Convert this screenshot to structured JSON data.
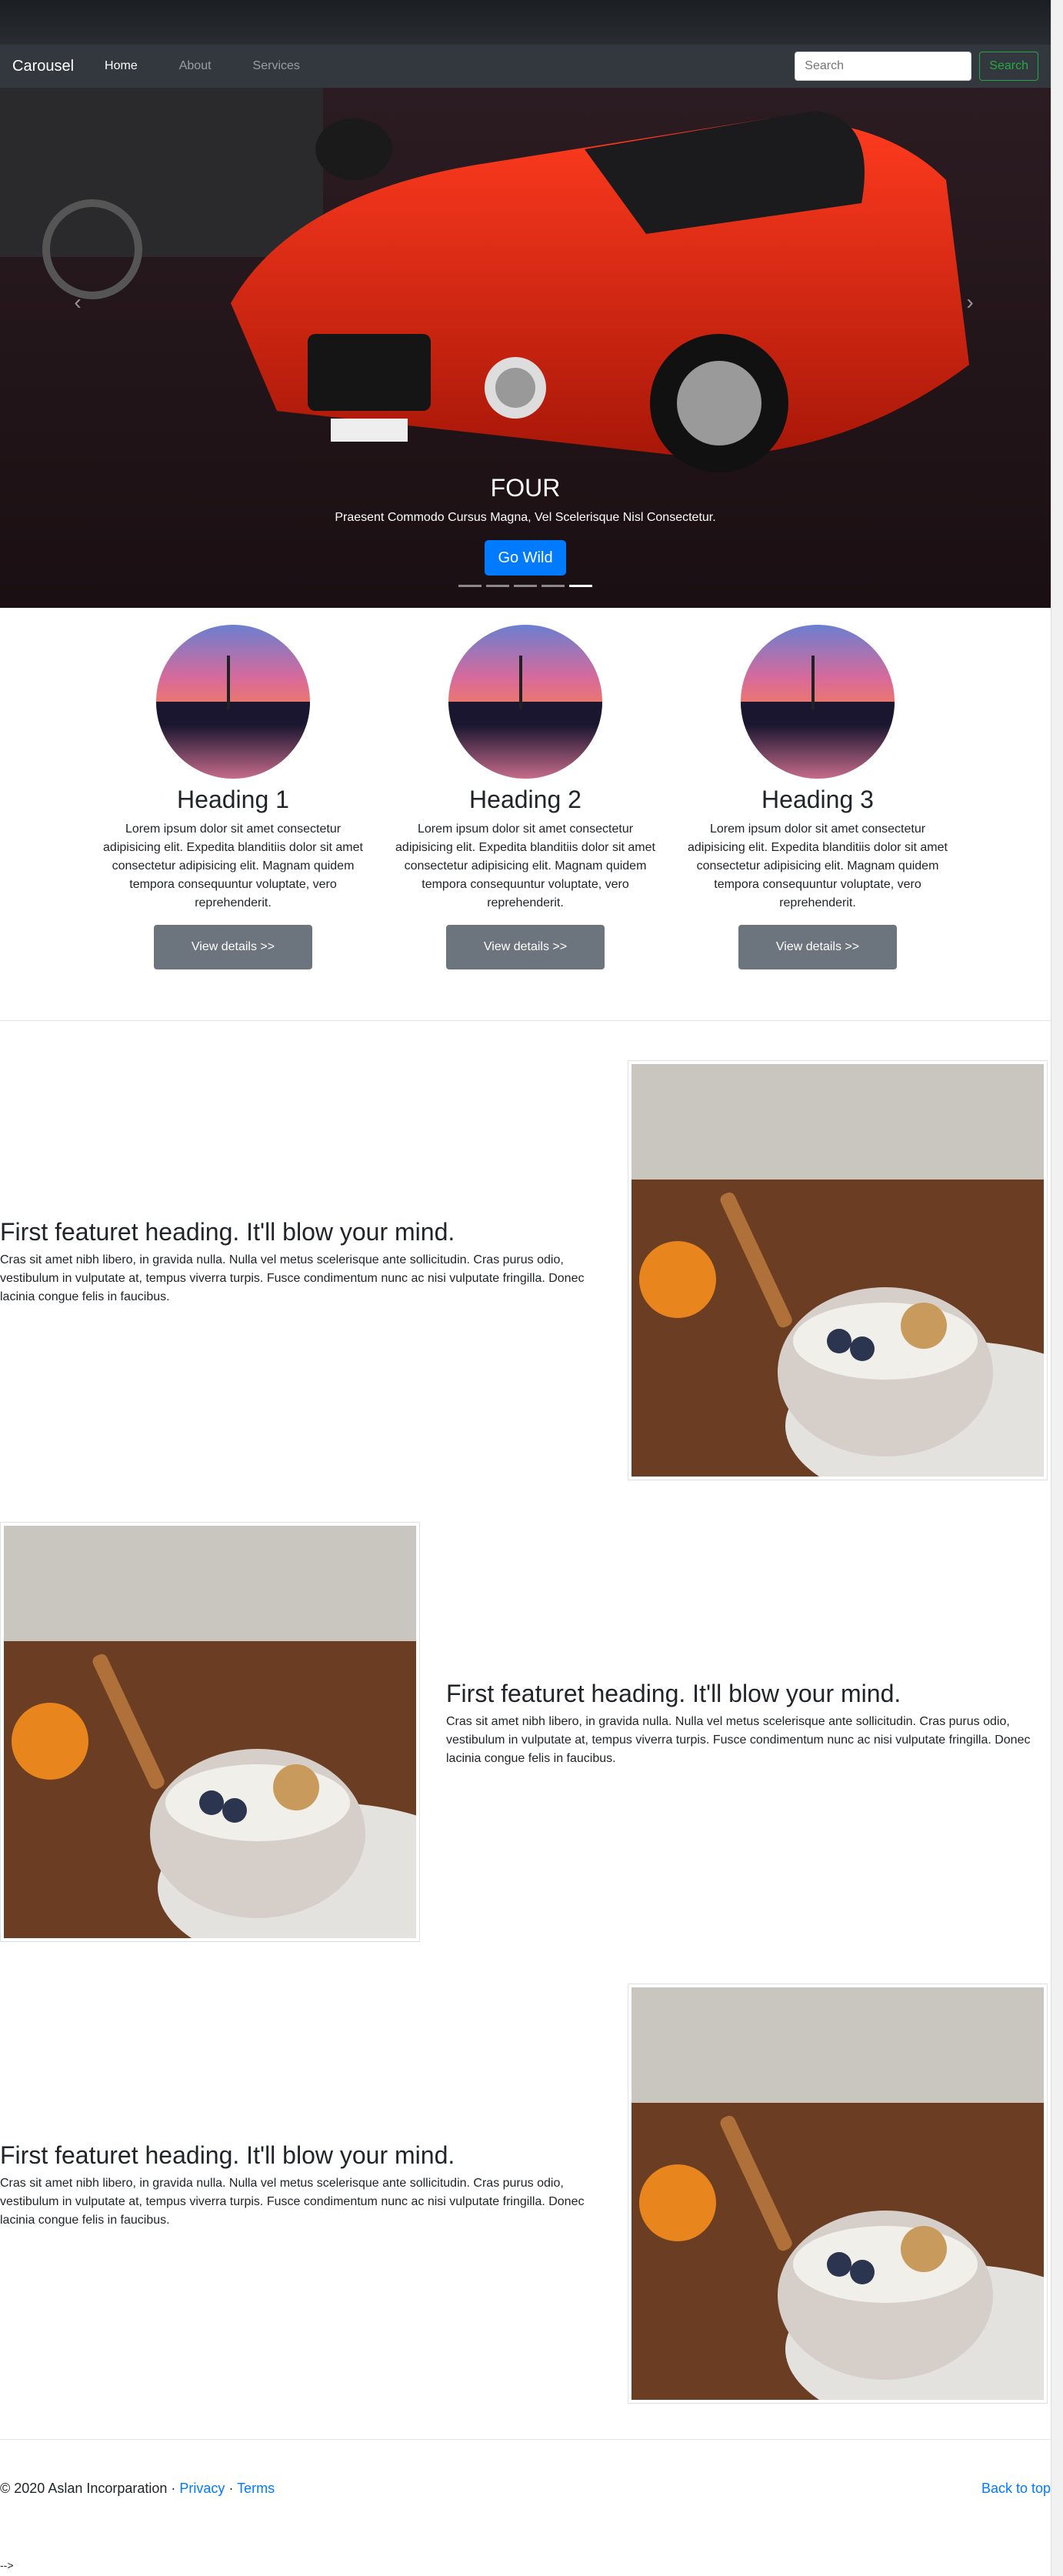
{
  "navbar": {
    "brand": "Carousel",
    "links": [
      "Home",
      "About",
      "Services"
    ],
    "search_placeholder": "Search",
    "search_button": "Search"
  },
  "carousel": {
    "title": "FOUR",
    "text": "Praesent Commodo Cursus Magna, Vel Scelerisque Nisl Consectetur.",
    "button": "Go Wild",
    "prev_icon": "chevron-left-icon",
    "next_icon": "chevron-right-icon",
    "active_slide_index": 4
  },
  "columns": [
    {
      "heading": "Heading 1",
      "text": "Lorem ipsum dolor sit amet consectetur adipisicing elit. Expedita blanditiis dolor sit amet consectetur adipisicing elit. Magnam quidem tempora consequuntur voluptate, vero reprehenderit.",
      "button": "View details >>"
    },
    {
      "heading": "Heading 2",
      "text": "Lorem ipsum dolor sit amet consectetur adipisicing elit. Expedita blanditiis dolor sit amet consectetur adipisicing elit. Magnam quidem tempora consequuntur voluptate, vero reprehenderit.",
      "button": "View details >>"
    },
    {
      "heading": "Heading 3",
      "text": "Lorem ipsum dolor sit amet consectetur adipisicing elit. Expedita blanditiis dolor sit amet consectetur adipisicing elit. Magnam quidem tempora consequuntur voluptate, vero reprehenderit.",
      "button": "View details >>"
    }
  ],
  "features": [
    {
      "heading": "First featuret heading. It'll blow your mind.",
      "text": "Cras sit amet nibh libero, in gravida nulla. Nulla vel metus scelerisque ante sollicitudin. Cras purus odio, vestibulum in vulputate at, tempus viverra turpis. Fusce condimentum nunc ac nisi vulputate fringilla. Donec lacinia congue felis in faucibus."
    },
    {
      "heading": "First featuret heading. It'll blow your mind.",
      "text": "Cras sit amet nibh libero, in gravida nulla. Nulla vel metus scelerisque ante sollicitudin. Cras purus odio, vestibulum in vulputate at, tempus viverra turpis. Fusce condimentum nunc ac nisi vulputate fringilla. Donec lacinia congue felis in faucibus."
    },
    {
      "heading": "First featuret heading. It'll blow your mind.",
      "text": "Cras sit amet nibh libero, in gravida nulla. Nulla vel metus scelerisque ante sollicitudin. Cras purus odio, vestibulum in vulputate at, tempus viverra turpis. Fusce condimentum nunc ac nisi vulputate fringilla. Donec lacinia congue felis in faucibus."
    }
  ],
  "footer": {
    "copyright": "© 2020 Aslan Incorparation ·",
    "privacy": "Privacy",
    "sep": "·",
    "terms": "Terms",
    "back_to_top": "Back to top"
  },
  "trailer": "-->",
  "colors": {
    "primary": "#007bff",
    "secondary": "#6c757d",
    "success": "#28a745",
    "navbar": "#343a40"
  }
}
